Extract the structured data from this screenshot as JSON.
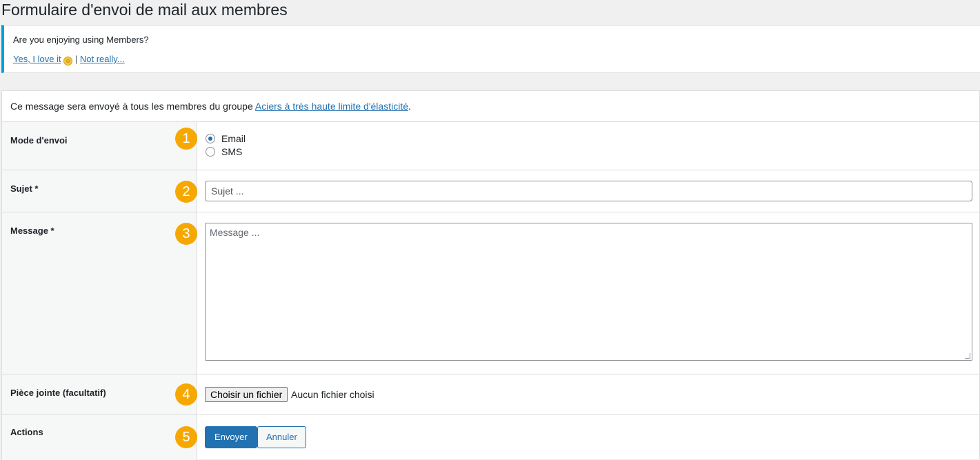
{
  "page": {
    "title": "Formulaire d'envoi de mail aux membres"
  },
  "notice": {
    "question": "Are you enjoying using Members?",
    "yes_link": "Yes, I love it",
    "separator": "|",
    "no_link": "Not really...",
    "accent_color": "#00a0d2"
  },
  "form": {
    "intro_prefix": "Ce message sera envoyé à tous les membres du groupe ",
    "group_link": "Aciers à très haute limite d'élasticité",
    "intro_suffix": ".",
    "mode": {
      "label": "Mode d'envoi",
      "badge": "1",
      "options": [
        {
          "label": "Email",
          "checked": true
        },
        {
          "label": "SMS",
          "checked": false
        }
      ]
    },
    "subject": {
      "label": "Sujet *",
      "badge": "2",
      "placeholder": "Sujet ..."
    },
    "message": {
      "label": "Message *",
      "badge": "3",
      "placeholder": "Message ..."
    },
    "attachment": {
      "label": "Pièce jointe (facultatif)",
      "badge": "4",
      "button": "Choisir un fichier",
      "status": "Aucun fichier choisi"
    },
    "actions": {
      "label": "Actions",
      "badge": "5",
      "submit": "Envoyer",
      "cancel": "Annuler"
    }
  },
  "colors": {
    "primary": "#2271b1",
    "badge": "#f7a800"
  }
}
